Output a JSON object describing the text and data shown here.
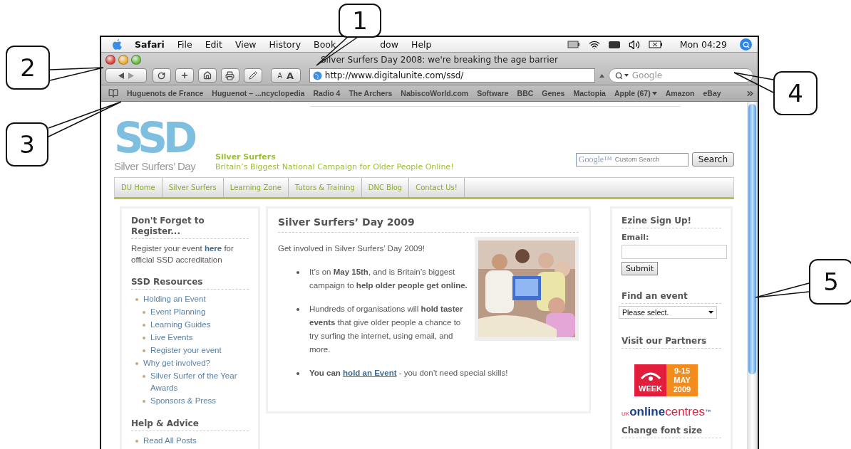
{
  "callouts": [
    {
      "label": "1"
    },
    {
      "label": "2"
    },
    {
      "label": "3"
    },
    {
      "label": "4"
    },
    {
      "label": "5"
    }
  ],
  "menubar": {
    "app": "Safari",
    "items": [
      "File",
      "Edit",
      "View",
      "History",
      "Book",
      "dow",
      "Help"
    ],
    "clock": "Mon 04:29"
  },
  "window": {
    "title": "Silver Surfers Day 2008: we're breaking the age barrier"
  },
  "toolbar": {
    "text_smaller": "A",
    "text_bigger": "A",
    "address": "http://www.digitalunite.com/ssd/",
    "search_placeholder": "Google"
  },
  "bookmarks": [
    {
      "label": "Huguenots de France",
      "menu": false
    },
    {
      "label": "Huguenot – ...ncyclopedia",
      "menu": false
    },
    {
      "label": "Radio 4",
      "menu": false
    },
    {
      "label": "The Archers",
      "menu": false
    },
    {
      "label": "NabiscoWorld.com",
      "menu": false
    },
    {
      "label": "Software",
      "menu": false
    },
    {
      "label": "BBC",
      "menu": false
    },
    {
      "label": "Genes",
      "menu": false
    },
    {
      "label": "Mactopia",
      "menu": false
    },
    {
      "label": "Apple (67)",
      "menu": true
    },
    {
      "label": "Amazon",
      "menu": false
    },
    {
      "label": "eBay",
      "menu": false
    }
  ],
  "site": {
    "logo": "SSD",
    "logo_caption": "Silver Surfers’ Day",
    "name": "Silver Surfers",
    "tagline": "Britain’s Biggest National Campaign for Older People Online!",
    "search": {
      "brand": "Google™",
      "placeholder": "Custom Search",
      "button": "Search"
    },
    "nav": [
      "DU Home",
      "Silver Surfers",
      "Learning Zone",
      "Tutors & Training",
      "DNC Blog",
      "Contact Us!"
    ]
  },
  "left": [
    {
      "title": "Don't Forget to Register...",
      "kind": "text",
      "before": "Register your event ",
      "link": "here",
      "after": " for official SSD accreditation"
    },
    {
      "title": "SSD Resources",
      "kind": "links",
      "items": [
        {
          "label": "Holding an Event",
          "children": [
            {
              "label": "Event Planning"
            },
            {
              "label": "Learning Guides"
            },
            {
              "label": "Live Events"
            },
            {
              "label": "Register your event"
            }
          ]
        },
        {
          "label": "Why get involved?",
          "children": [
            {
              "label": "Silver Surfer of the Year Awards"
            },
            {
              "label": "Sponsors & Press"
            }
          ]
        }
      ]
    },
    {
      "title": "Help & Advice",
      "kind": "links",
      "items": [
        {
          "label": "Read All Posts"
        }
      ]
    }
  ],
  "main": {
    "title": "Silver Surfers’ Day 2009",
    "intro": "Get involved in Silver Surfers’ Day 2009!",
    "bullets": [
      {
        "kind": "text",
        "text": "It’s on **May 15th**, and is Britain’s biggest campaign to **help older people get online.**"
      },
      {
        "kind": "text",
        "text": "Hundreds of organisations will **hold taster events** that give older people a chance to try surfing the internet, using email, and more."
      },
      {
        "kind": "link",
        "text": "**You can** ",
        "link": "hold an Event",
        "after": " - you don’t need special skills!"
      }
    ]
  },
  "right": {
    "signup_title": "Ezine Sign Up!",
    "email_label": "Email:",
    "submit": "Submit",
    "find_title": "Find an event",
    "select_value": "Please select.",
    "partners_title": "Visit our Partners",
    "alw_logo": {
      "week": "WEEK",
      "dates": "9-15",
      "month": "MAY",
      "year": "2009"
    },
    "ukonline_logo": {
      "prefix": "UK",
      "online": "online",
      "centres": "centres",
      "mark": "™"
    },
    "font_title": "Change font size"
  }
}
